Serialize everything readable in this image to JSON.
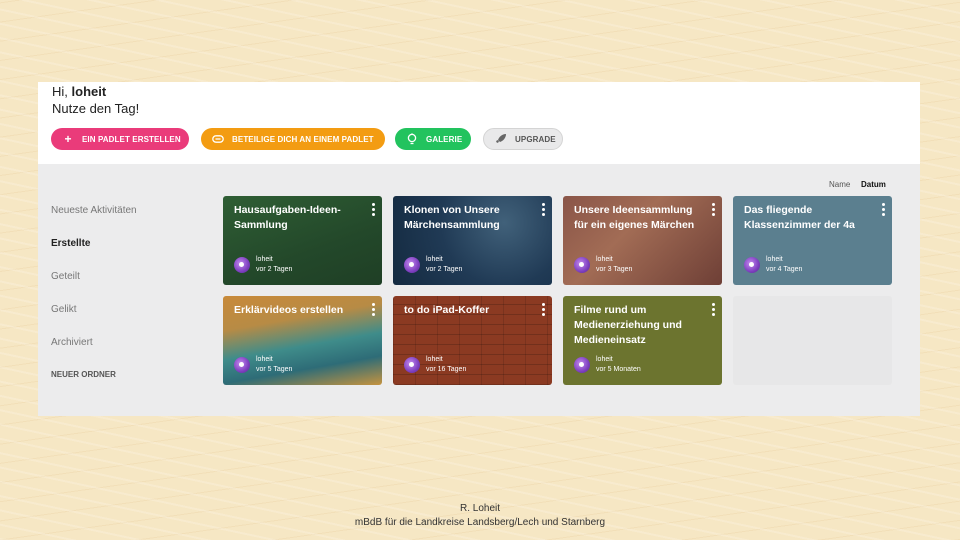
{
  "header": {
    "greeting_prefix": "Hi,",
    "user": "loheit",
    "subtitle": "Nutze den Tag!"
  },
  "actions": [
    {
      "label": "EIN PADLET ERSTELLEN",
      "icon": "plus-icon",
      "color": "#ea3b7a"
    },
    {
      "label": "BETEILIGE DICH AN EINEM PADLET",
      "icon": "link-icon",
      "color": "#f39c12"
    },
    {
      "label": "GALERIE",
      "icon": "lightbulb-icon",
      "color": "#22c35e"
    },
    {
      "label": "UPGRADE",
      "icon": "rocket-icon",
      "color": "#e9e9ea"
    }
  ],
  "sort": {
    "name": "Name",
    "date": "Datum",
    "active": "date"
  },
  "sidebar": [
    {
      "label": "Neueste Aktivitäten",
      "active": false
    },
    {
      "label": "Erstellte",
      "active": true
    },
    {
      "label": "Geteilt",
      "active": false
    },
    {
      "label": "Gelikt",
      "active": false
    },
    {
      "label": "Archiviert",
      "active": false
    },
    {
      "label": "NEUER ORDNER",
      "active": false
    }
  ],
  "cards": [
    {
      "title": "Hausaufgaben-Ideen-Sammlung",
      "author": "loheit",
      "time": "vor 2 Tagen"
    },
    {
      "title": "Klonen von Unsere Märchensammlung",
      "author": "loheit",
      "time": "vor 2 Tagen"
    },
    {
      "title": "Unsere Ideensammlung für ein eigenes Märchen",
      "author": "loheit",
      "time": "vor 3 Tagen"
    },
    {
      "title": "Das fliegende Klassenzimmer der 4a",
      "author": "loheit",
      "time": "vor 4 Tagen"
    },
    {
      "title": "Erklärvideos erstellen",
      "author": "loheit",
      "time": "vor 5 Tagen"
    },
    {
      "title": "to do iPad-Koffer",
      "author": "loheit",
      "time": "vor 16 Tagen"
    },
    {
      "title": "Filme rund um Medienerziehung und Medieneinsatz",
      "author": "loheit",
      "time": "vor 5 Monaten"
    }
  ],
  "footer": {
    "line1": "R. Loheit",
    "line2": "mBdB für die Landkreise Landsberg/Lech und Starnberg"
  }
}
